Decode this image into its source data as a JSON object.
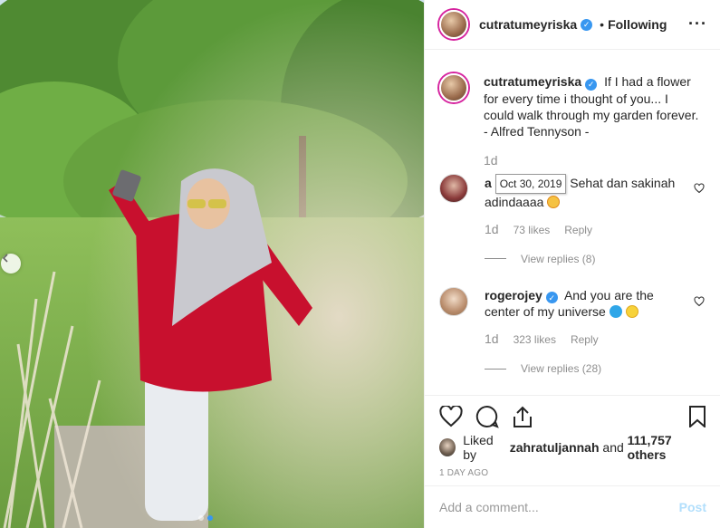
{
  "post": {
    "author": "cutratumeyriska",
    "follow_status": "Following",
    "more_icon": "more-horizontal-icon"
  },
  "caption": {
    "username": "cutratumeyriska",
    "text": "If I had a flower for every time i thought of you... I could walk through my garden forever.",
    "attribution": "- Alfred Tennyson -",
    "time": "1d"
  },
  "comments": [
    {
      "username": "a",
      "tooltip": "Oct 30, 2019",
      "text": "Sehat dan sakinah adindaaaa",
      "emoji": "smiling-face-emoji",
      "time": "1d",
      "likes": "73 likes",
      "reply_label": "Reply",
      "view_replies": "View replies (8)"
    },
    {
      "username": "rogerojey",
      "text": "And you are the center of my universe",
      "emoji": "blue-heart-sun-emoji",
      "time": "1d",
      "likes": "323 likes",
      "reply_label": "Reply",
      "view_replies": "View replies (28)"
    }
  ],
  "liked_by": {
    "prefix": "Liked by",
    "user": "zahratuljannah",
    "and": "and",
    "count": "111,757 others"
  },
  "time_ago": "1 DAY AGO",
  "add_comment": {
    "placeholder": "Add a comment...",
    "post_label": "Post"
  },
  "colors": {
    "accent": "#3897f0",
    "verified": "#3897f0",
    "muted": "#8e8e8e",
    "post_disabled": "#b2dffc"
  },
  "carousel": {
    "current": 2,
    "total": 2
  }
}
